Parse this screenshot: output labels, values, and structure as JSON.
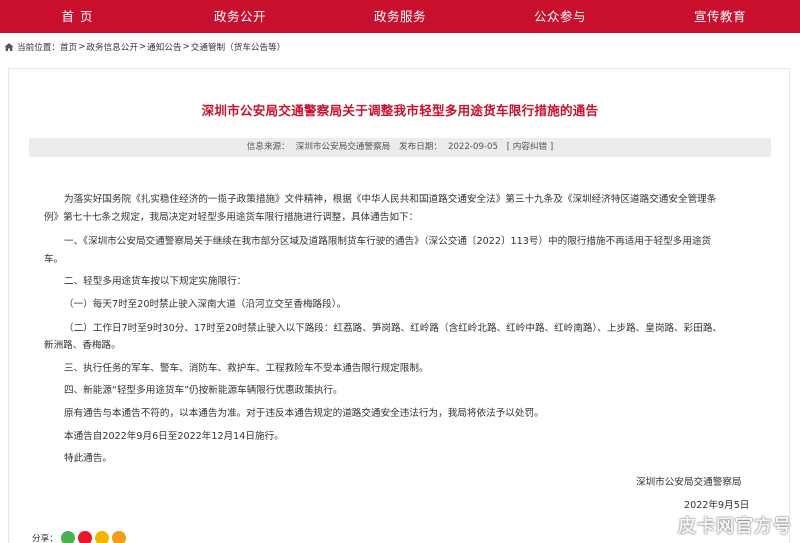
{
  "nav": {
    "items": [
      "首页",
      "政务公开",
      "政务服务",
      "公众参与",
      "宣传教育"
    ]
  },
  "breadcrumb": {
    "prefix": "当前位置：",
    "items": [
      "首页",
      "政务信息公开",
      "通知公告",
      "交通管制（货车公告等）"
    ],
    "separator": ">"
  },
  "article": {
    "title": "深圳市公安局交通警察局关于调整我市轻型多用途货车限行措施的通告",
    "info_source_label": "信息来源：",
    "info_source": "深圳市公安局交通警察局",
    "publish_date_label": "发布日期：",
    "publish_date": "2022-09-05",
    "error_link": "[ 内容纠错 ]",
    "paragraphs": [
      "为落实好国务院《扎实稳住经济的一揽子政策措施》文件精神，根据《中华人民共和国道路交通安全法》第三十九条及《深圳经济特区道路交通安全管理条",
      "例》第七十七条之规定，我局决定对轻型多用途货车限行措施进行调整，具体通告如下：",
      "一、《深圳市公安局交通警察局关于继续在我市部分区域及道路限制货车行驶的通告》（深公交通〔2022〕113号）中的限行措施不再适用于轻型多用途货",
      "车。",
      "二、轻型多用途货车按以下规定实施限行：",
      "（一）每天7时至20时禁止驶入深南大道（沿河立交至香梅路段）。",
      "（二）工作日7时至9时30分、17时至20时禁止驶入以下路段：红荔路、笋岗路、红岭路（含红岭北路、红岭中路、红岭南路）、上步路、皇岗路、彩田路、",
      "新洲路、香梅路。",
      "三、执行任务的军车、警车、消防车、救护车、工程救险车不受本通告限行规定限制。",
      "四、新能源“轻型多用途货车”仍按新能源车辆限行优惠政策执行。",
      "原有通告与本通告不符的，以本通告为准。对于违反本通告规定的道路交通安全违法行为，我局将依法予以处罚。",
      "本通告自2022年9月6日至2022年12月14日施行。",
      "特此通告。"
    ],
    "signature": "深圳市公安局交通警察局",
    "sign_date": "2022年9月5日"
  },
  "share": {
    "label": "分享：",
    "icons": [
      {
        "name": "wechat-share-icon",
        "color": "#4caf50"
      },
      {
        "name": "weibo-share-icon",
        "color": "#e6162d"
      },
      {
        "name": "qzone-share-icon",
        "color": "#f5b400"
      },
      {
        "name": "qq-share-icon",
        "color": "#f29b1d"
      }
    ]
  },
  "watermark": {
    "text": "皮卡网官方号"
  },
  "colors": {
    "nav_bg": "#c8102e",
    "title_color": "#c8102e",
    "info_bar_bg": "#ececec"
  }
}
